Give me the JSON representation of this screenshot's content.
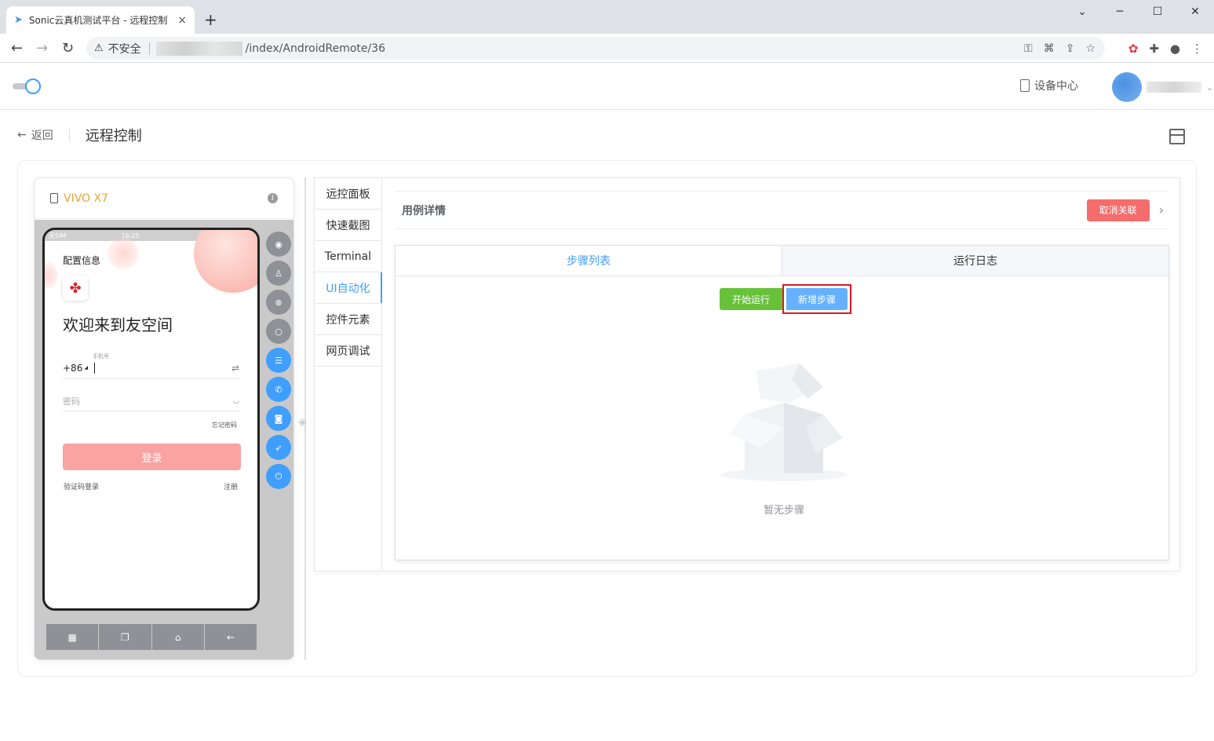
{
  "browser": {
    "tab_title": "Sonic云真机测试平台 - 远程控制",
    "tab_close": "×",
    "new_tab": "+",
    "insecure_label": "不安全",
    "url": "/index/AndroidRemote/36"
  },
  "header": {
    "device_center": "设备中心"
  },
  "page": {
    "back_label": "返回",
    "title": "远程控制"
  },
  "device": {
    "name": "VIVO X7",
    "status_carrier": "无SIM",
    "status_time": "16:25",
    "app": {
      "config_label": "配置信息",
      "welcome": "欢迎来到友空间",
      "country_code": "+86",
      "phone_hint": "手机号",
      "password_placeholder": "密码",
      "forgot_password": "忘记密码",
      "login_button": "登录",
      "sms_login": "验证码登录",
      "register": "注册"
    }
  },
  "vertical_tabs": [
    {
      "label": "远控面板"
    },
    {
      "label": "快速截图"
    },
    {
      "label": "Terminal"
    },
    {
      "label": "UI自动化"
    },
    {
      "label": "控件元素"
    },
    {
      "label": "网页调试"
    }
  ],
  "case_detail": {
    "title": "用例详情",
    "unlink_button": "取消关联"
  },
  "steps": {
    "tabs": [
      {
        "label": "步骤列表"
      },
      {
        "label": "运行日志"
      }
    ],
    "run_button": "开始运行",
    "add_button": "新增步骤",
    "empty_text": "暂无步骤"
  },
  "colors": {
    "primary": "#409eff",
    "success": "#67c23a",
    "danger": "#f56c6c",
    "highlight": "#e0191f"
  }
}
